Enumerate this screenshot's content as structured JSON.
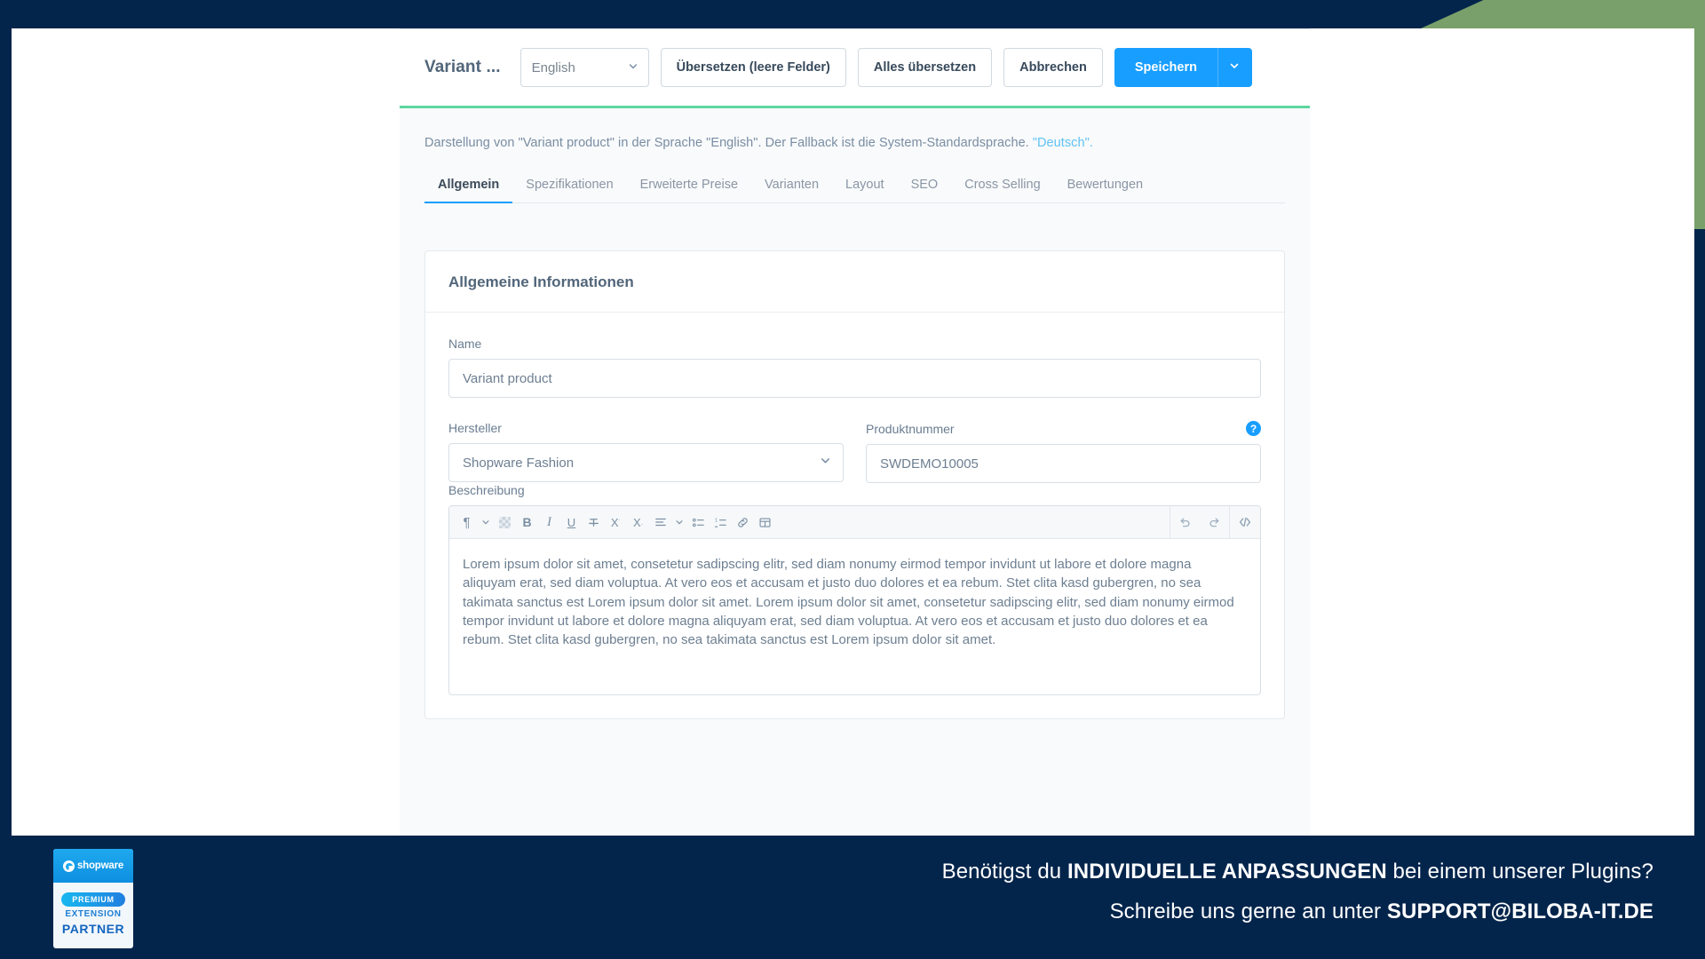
{
  "frame": {
    "navy": "#03254c",
    "green": "#79a06a"
  },
  "header": {
    "title": "Variant ...",
    "language_select": {
      "value": "English",
      "icon": "chevron-down-icon"
    },
    "buttons": {
      "translate_empty": "Übersetzen (leere Felder)",
      "translate_all": "Alles übersetzen",
      "cancel": "Abbrechen",
      "save": "Speichern",
      "save_dropdown_icon": "chevron-down-icon"
    },
    "accent_color": "#5ed6a0",
    "primary_color": "#189eff"
  },
  "notice": {
    "text_before": "Darstellung von \"Variant product\" in der Sprache \"English\". Der Fallback ist die System-Standardsprache. ",
    "link": "\"Deutsch\"."
  },
  "tabs": [
    {
      "label": "Allgemein",
      "active": true
    },
    {
      "label": "Spezifikationen",
      "active": false
    },
    {
      "label": "Erweiterte Preise",
      "active": false
    },
    {
      "label": "Varianten",
      "active": false
    },
    {
      "label": "Layout",
      "active": false
    },
    {
      "label": "SEO",
      "active": false
    },
    {
      "label": "Cross Selling",
      "active": false
    },
    {
      "label": "Bewertungen",
      "active": false
    }
  ],
  "card": {
    "title": "Allgemeine Informationen",
    "fields": {
      "name": {
        "label": "Name",
        "value": "Variant product"
      },
      "manufacturer": {
        "label": "Hersteller",
        "value": "Shopware Fashion",
        "icon": "chevron-down-icon"
      },
      "product_number": {
        "label": "Produktnummer",
        "value": "SWDEMO10005",
        "help_icon": "help-circle-icon"
      },
      "description": {
        "label": "Beschreibung"
      }
    },
    "editor": {
      "toolbar_left": [
        {
          "name": "paragraph-format-icon",
          "glyph": "¶"
        },
        {
          "name": "paragraph-format-chevron-icon",
          "glyph": "⌄"
        },
        {
          "name": "text-color-swatch-icon",
          "glyph": ""
        },
        {
          "name": "bold-icon",
          "glyph": "B"
        },
        {
          "name": "italic-icon",
          "glyph": "I"
        },
        {
          "name": "underline-icon",
          "glyph": "U"
        },
        {
          "name": "strikethrough-icon",
          "glyph": "T̶"
        },
        {
          "name": "superscript-icon",
          "glyph": "X˙"
        },
        {
          "name": "subscript-icon",
          "glyph": "X."
        },
        {
          "name": "align-icon",
          "glyph": "≡"
        },
        {
          "name": "align-chevron-icon",
          "glyph": "⌄"
        },
        {
          "name": "bullet-list-icon",
          "glyph": "⁚≡"
        },
        {
          "name": "ordered-list-icon",
          "glyph": "1≡"
        },
        {
          "name": "link-icon",
          "glyph": "🔗"
        },
        {
          "name": "table-icon",
          "glyph": "⊞"
        }
      ],
      "toolbar_right": [
        {
          "name": "undo-icon",
          "glyph": "↺"
        },
        {
          "name": "redo-icon",
          "glyph": "↻"
        },
        {
          "name": "code-view-icon",
          "glyph": "‹›"
        }
      ],
      "content": "Lorem ipsum dolor sit amet, consetetur sadipscing elitr, sed diam nonumy eirmod tempor invidunt ut labore et dolore magna aliquyam erat, sed diam voluptua. At vero eos et accusam et justo duo dolores et ea rebum. Stet clita kasd gubergren, no sea takimata sanctus est Lorem ipsum dolor sit amet. Lorem ipsum dolor sit amet, consetetur sadipscing elitr, sed diam nonumy eirmod tempor invidunt ut labore et dolore magna aliquyam erat, sed diam voluptua. At vero eos et accusam et justo duo dolores et ea rebum. Stet clita kasd gubergren, no sea takimata sanctus est Lorem ipsum dolor sit amet."
    }
  },
  "promo": {
    "badge": {
      "brand": "shopware",
      "pill": "PREMIUM",
      "line1": "EXTENSION",
      "line2": "PARTNER"
    },
    "line1_a": "Benötigst du ",
    "line1_b": "INDIVIDUELLE ANPASSUNGEN",
    "line1_c": " bei einem unserer Plugins?",
    "line2_a": "Schreibe uns gerne an unter ",
    "line2_b": "SUPPORT@BILOBA-IT.DE"
  }
}
